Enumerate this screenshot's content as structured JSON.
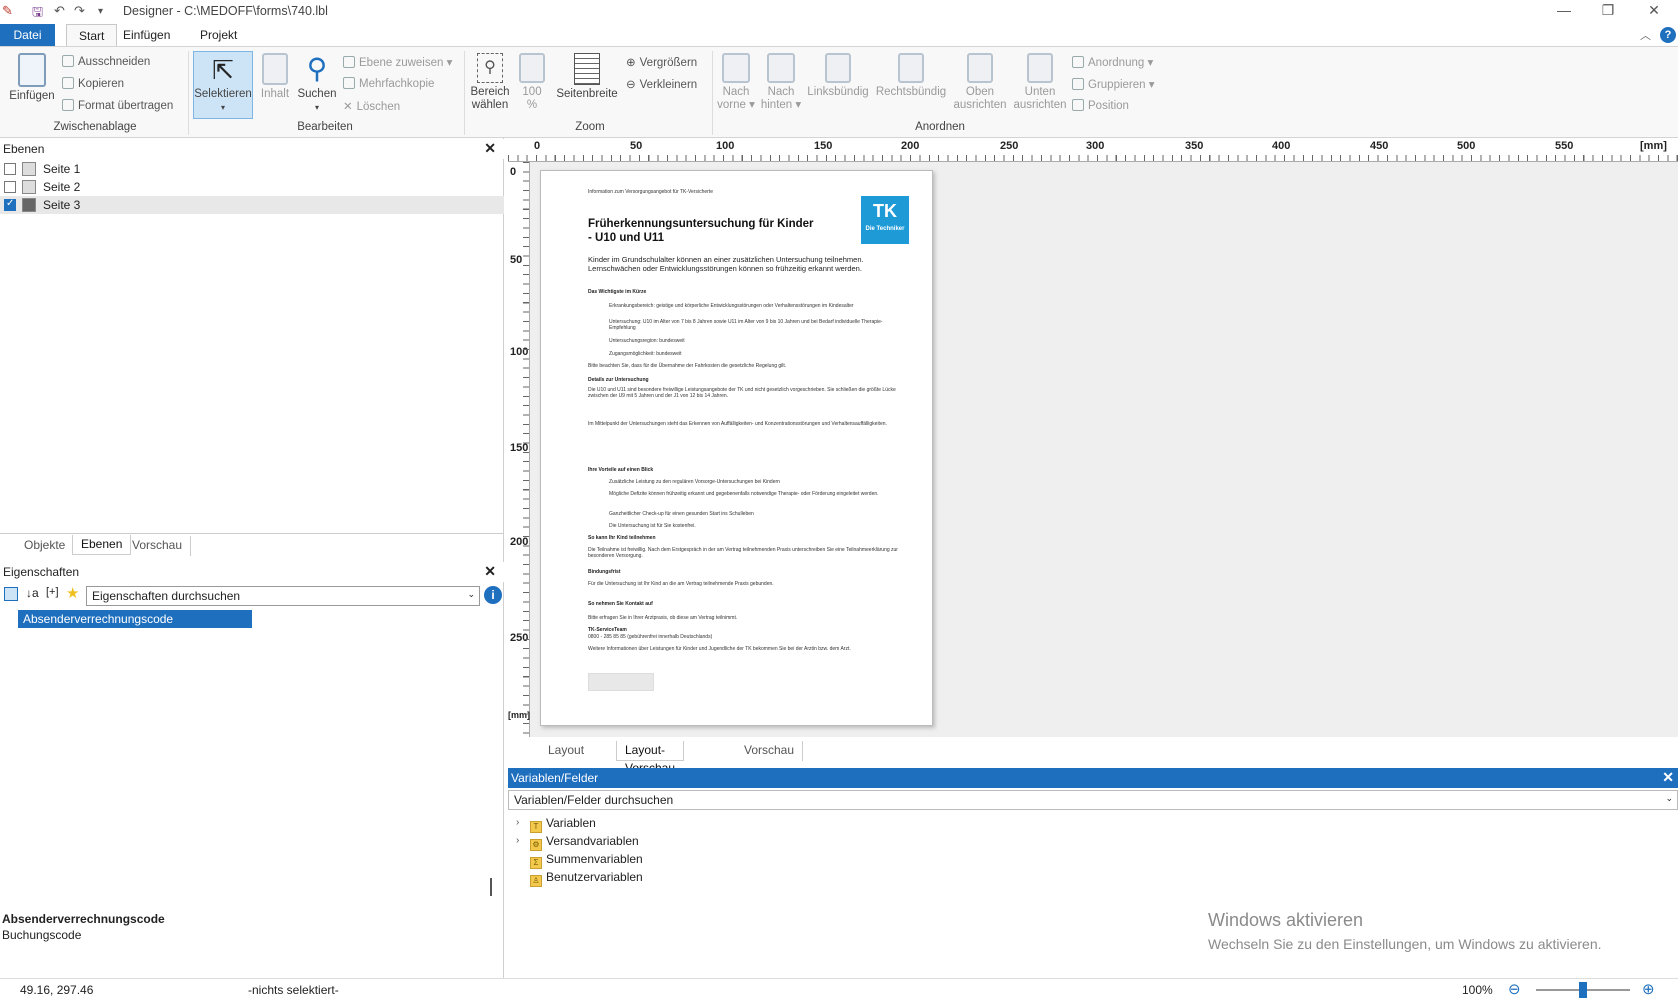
{
  "window": {
    "title": "Designer - C:\\MEDOFF\\forms\\740.lbl",
    "minimize": "—",
    "restore": "❐",
    "close": "✕"
  },
  "menu": {
    "file": "Datei",
    "tabs": [
      "Start",
      "Einfügen",
      "Projekt"
    ]
  },
  "ribbon": {
    "clipboard": {
      "paste": "Einfügen",
      "cut": "Ausschneiden",
      "copy": "Kopieren",
      "format": "Format übertragen",
      "group": "Zwischenablage"
    },
    "edit": {
      "select": "Selektieren",
      "content": "Inhalt",
      "search": "Suchen",
      "assign_layer": "Ebene zuweisen",
      "multi_copy": "Mehrfachkopie",
      "delete": "Löschen",
      "group": "Bearbeiten"
    },
    "zoom": {
      "area_1": "Bereich",
      "area_2": "wählen",
      "hundred_1": "100",
      "hundred_2": "%",
      "page_width": "Seitenbreite",
      "zoom_in": "Vergrößern",
      "zoom_out": "Verkleinern",
      "group": "Zoom"
    },
    "arrange": {
      "front_1": "Nach",
      "front_2": "vorne",
      "back_1": "Nach",
      "back_2": "hinten",
      "left": "Linksbündig",
      "right": "Rechtsbündig",
      "top_1": "Oben",
      "top_2": "ausrichten",
      "bottom_1": "Unten",
      "bottom_2": "ausrichten",
      "arrangement": "Anordnung",
      "grouping": "Gruppieren",
      "position": "Position",
      "group": "Anordnen"
    }
  },
  "layers_panel": {
    "title": "Ebenen",
    "items": [
      {
        "label": "Seite 1",
        "checked": false
      },
      {
        "label": "Seite 2",
        "checked": false
      },
      {
        "label": "Seite 3",
        "checked": true
      }
    ],
    "tabs": [
      "Objekte",
      "Ebenen",
      "Vorschau"
    ],
    "active_tab": "Ebenen"
  },
  "properties_panel": {
    "title": "Eigenschaften",
    "search_value": "Eigenschaften durchsuchen",
    "selected_item": "Absenderverrechnungscode",
    "desc_title": "Absenderverrechnungscode",
    "desc_text": "Buchungscode"
  },
  "ruler": {
    "h_labels": [
      "0",
      "50",
      "100",
      "150",
      "200",
      "250",
      "300",
      "350",
      "400",
      "450",
      "500",
      "550",
      "[mm]"
    ],
    "v_labels": [
      "0",
      "50",
      "100",
      "150",
      "200",
      "250",
      "[mm]"
    ]
  },
  "document": {
    "top_note": "Information zum Versorgungsangebot für TK-Versicherte",
    "title_1": "Früherkennungsuntersuchung für Kinder",
    "title_2": "- U10 und U11",
    "subtitle_1": "Kinder im Grundschulalter können an einer zusätzlichen Untersuchung teilnehmen.",
    "subtitle_2": "Lernschwächen oder Entwicklungsstörungen können so frühzeitig erkannt werden.",
    "logo": "TK",
    "logo_sub": "Die Techniker",
    "h_kurz": "Das Wichtigste im Kürze",
    "b1": "Erkrankungsbereich: geistige und körperliche Entwicklungsstörungen oder Verhaltensstörungen im Kindesalter",
    "b2": "Untersuchung: U10 im Alter von 7 bis 8 Jahren sowie U11 im Alter von 9 bis 10 Jahren und bei Bedarf individuelle Therapie-Empfehlung",
    "b3": "Untersuchungsregion: bundesweit",
    "b4": "Zugangsmöglichkeit: bundesweit",
    "note": "Bitte beachten Sie, dass für die Übernahme der Fahrkosten die gesetzliche Regelung gilt.",
    "h_details": "Details zur Untersuchung",
    "p1": "Die U10 und U11 sind besondere freiwillige Leistungsangebote der TK und nicht gesetzlich vorgeschrieben. Sie schließen die größte Lücke zwischen der U9 mit 5 Jahren und der J1 von 12 bis 14 Jahren.",
    "p2": "Im Mittelpunkt der Untersuchungen steht das Erkennen von Auffälligkeiten- und Konzentrationsstörungen und Verhaltensauffälligkeiten.",
    "h_vorteile": "Ihre Vorteile auf einen Blick",
    "v1": "Zusätzliche Leistung zu den regulären Vorsorge-Untersuchungen bei Kindern",
    "v2": "Mögliche Defizite können frühzeitig erkannt und gegebenenfalls notwendige Therapie- oder Förderung eingeleitet werden.",
    "v3": "Ganzheitlicher Check-up für einen gesunden Start ins Schulleben",
    "v4": "Die Untersuchung ist für Sie kostenfrei.",
    "h_teilnehmen": "So kann Ihr Kind teilnehmen",
    "p3": "Die Teilnahme ist freiwillig. Nach dem Erstgespräch in der am Vertrag teilnehmenden Praxis unterschreiben Sie eine Teilnahmeerklärung zur besonderen Versorgung.",
    "h_bindung": "Bindungsfrist",
    "p4": "Für die Untersuchung ist Ihr Kind an die am Vertrag teilnehmende Praxis gebunden.",
    "h_kontakt": "So nehmen Sie Kontakt auf",
    "p5": "Bitte erfragen Sie in Ihrer Arztpraxis, ob diese am Vertrag teilnimmt.",
    "service": "TK-ServiceTeam",
    "phone": "0800 - 285 85 85 (gebührenfrei innerhalb Deutschlands)",
    "p6": "Weitere Informationen über Leistungen für Kinder und Jugendliche der TK bekommen Sie bei der Arztin bzw. dem Arzt."
  },
  "view_tabs": [
    "Layout",
    "Layout-Vorschau",
    "Vorschau"
  ],
  "active_view_tab": "Layout-Vorschau",
  "variables_panel": {
    "title": "Variablen/Felder",
    "search": "Variablen/Felder durchsuchen",
    "items": [
      {
        "label": "Variablen",
        "icon": "T",
        "expandable": true
      },
      {
        "label": "Versandvariablen",
        "icon": "⚙",
        "expandable": true
      },
      {
        "label": "Summenvariablen",
        "icon": "Σ",
        "expandable": false
      },
      {
        "label": "Benutzervariablen",
        "icon": "♙",
        "expandable": false
      }
    ]
  },
  "watermark": {
    "line1": "Windows aktivieren",
    "line2": "Wechseln Sie zu den Einstellungen, um Windows zu aktivieren."
  },
  "status": {
    "coords": "49.16, 297.46",
    "selection": "-nichts selektiert-",
    "zoom": "100%",
    "zoom_level": 0.5
  },
  "colors": {
    "accent": "#1f6fbf",
    "tk_blue": "#1e9bd7"
  }
}
